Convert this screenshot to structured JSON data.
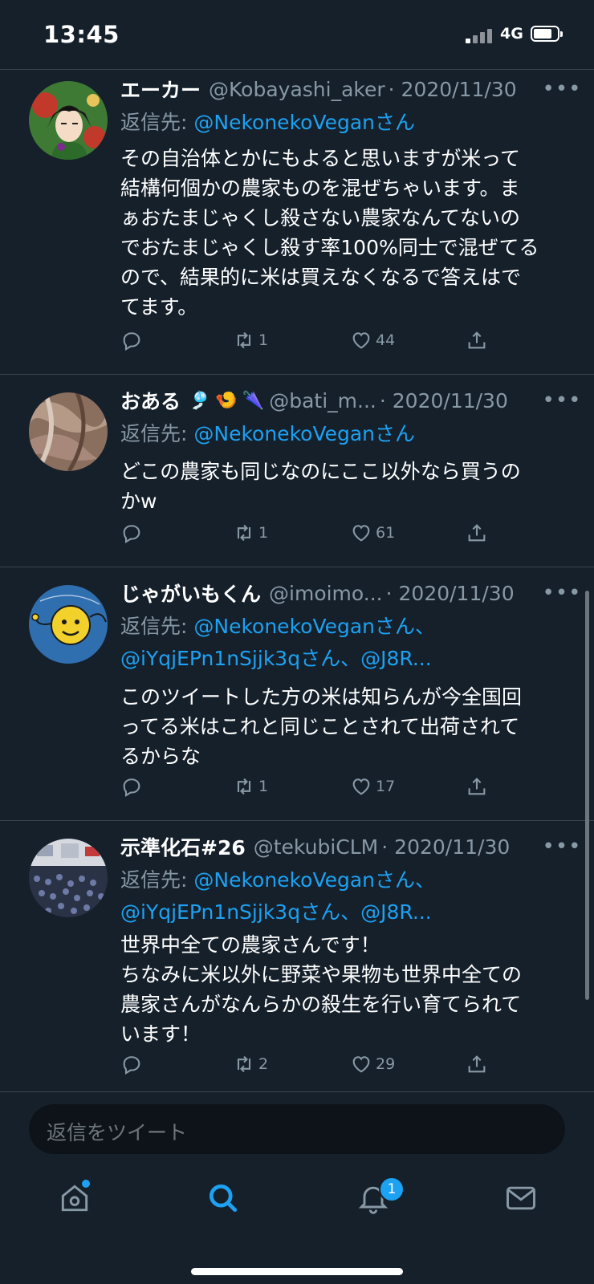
{
  "status": {
    "time": "13:45",
    "network": "4G"
  },
  "tweets": [
    {
      "name": "エーカー",
      "handle": "@Kobayashi_aker",
      "date": "· 2020/11/30",
      "reply_prefix": "返信先: ",
      "reply_to": "@NekonekoVeganさん",
      "reply_to_2": "",
      "text": "その自治体とかにもよると思いますが米って\n結構何個かの農家ものを混ぜちゃいます。ま\nぁおたまじゃくし殺さない農家なんてないの\nでおたまじゃくし殺す率100%同士で混ぜてる\nので、結果的に米は買えなくなるで答えはで\nてます。",
      "retweets": "1",
      "likes": "44"
    },
    {
      "name": "おある",
      "emojis": [
        "🎐",
        "🍤",
        "🌂"
      ],
      "handle": "@bati_m...",
      "date": "· 2020/11/30",
      "reply_prefix": "返信先: ",
      "reply_to": "@NekonekoVeganさん",
      "reply_to_2": "",
      "text": "どこの農家も同じなのにここ以外なら買うの\nかw",
      "retweets": "1",
      "likes": "61"
    },
    {
      "name": "じゃがいもくん",
      "handle": "@imoimo...",
      "date": "· 2020/11/30",
      "reply_prefix": "返信先: ",
      "reply_to": "@NekonekoVeganさん、",
      "reply_to_2": "@iYqjEPn1nSjjk3qさん、@J8R...",
      "text": "このツイートした方の米は知らんが今全国回\nってる米はこれと同じことされて出荷されて\nるからな",
      "retweets": "1",
      "likes": "17"
    },
    {
      "name": "示準化石#26",
      "handle": "@tekubiCLM",
      "date": "· 2020/11/30",
      "reply_prefix": "返信先: ",
      "reply_to": "@NekonekoVeganさん、",
      "reply_to_2": "@iYqjEPn1nSjjk3qさん、@J8R...",
      "text": "世界中全ての農家さんです！\nちなみに米以外に野菜や果物も世界中全ての\n農家さんがなんらかの殺生を行い育てられて\nいます！",
      "retweets": "2",
      "likes": "29"
    }
  ],
  "composer": {
    "placeholder": "返信をツイート"
  },
  "tabbar": {
    "notification_count": "1",
    "icons": [
      "home-icon",
      "search-icon",
      "bell-icon",
      "mail-icon"
    ]
  },
  "colors": {
    "background": "#15202b",
    "accent": "#1da1f2",
    "muted": "#8899a6",
    "divider": "#38444d"
  }
}
